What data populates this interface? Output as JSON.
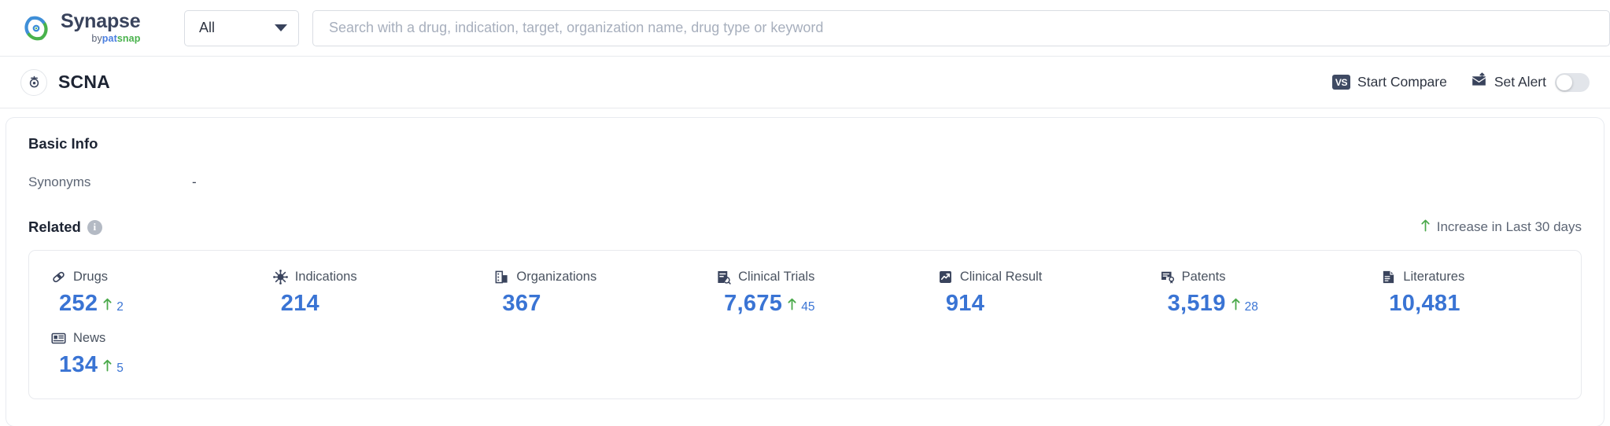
{
  "header": {
    "logo_name": "Synapse",
    "logo_by": "by",
    "logo_brand_pat": "pat",
    "logo_brand_snap": "snap",
    "category_select": "All",
    "search_placeholder": "Search with a drug, indication, target, organization name, drug type or keyword",
    "search_value": ""
  },
  "entity": {
    "title": "SCNA",
    "start_compare": "Start Compare",
    "compare_badge": "VS",
    "set_alert": "Set Alert",
    "alert_enabled": false
  },
  "basic_info": {
    "section_title": "Basic Info",
    "synonyms_label": "Synonyms",
    "synonyms_value": "-"
  },
  "related": {
    "title": "Related",
    "info_glyph": "i",
    "increase_note": "Increase in Last 30 days",
    "items": [
      {
        "icon": "pill-icon",
        "label": "Drugs",
        "value": "252",
        "delta": "2",
        "has_delta": true
      },
      {
        "icon": "virus-icon",
        "label": "Indications",
        "value": "214",
        "delta": "",
        "has_delta": false
      },
      {
        "icon": "organization-icon",
        "label": "Organizations",
        "value": "367",
        "delta": "",
        "has_delta": false
      },
      {
        "icon": "clinical-trial-icon",
        "label": "Clinical Trials",
        "value": "7,675",
        "delta": "45",
        "has_delta": true
      },
      {
        "icon": "clinical-result-icon",
        "label": "Clinical Result",
        "value": "914",
        "delta": "",
        "has_delta": false
      },
      {
        "icon": "patent-icon",
        "label": "Patents",
        "value": "3,519",
        "delta": "28",
        "has_delta": true
      },
      {
        "icon": "literature-icon",
        "label": "Literatures",
        "value": "10,481",
        "delta": "",
        "has_delta": false
      },
      {
        "icon": "news-icon",
        "label": "News",
        "value": "134",
        "delta": "5",
        "has_delta": true
      }
    ]
  },
  "colors": {
    "accent_blue": "#3a74d4",
    "increase_green": "#4aa94a",
    "text_dark": "#1d2433",
    "text_muted": "#5d6675",
    "border": "#e8eaee"
  }
}
